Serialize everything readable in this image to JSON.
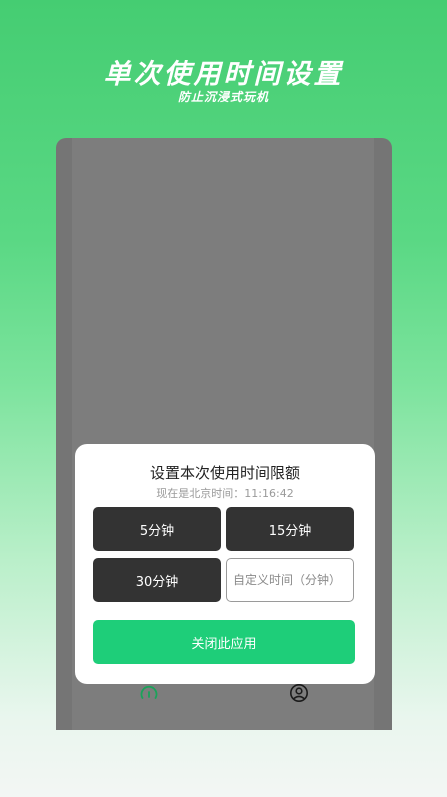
{
  "hero": {
    "title": "单次使用时间设置",
    "subtitle": "防止沉浸式玩机"
  },
  "dialog": {
    "title": "设置本次使用时间限额",
    "current_time_text": "现在是北京时间：11:16:42",
    "options": [
      {
        "label": "5分钟"
      },
      {
        "label": "15分钟"
      },
      {
        "label": "30分钟"
      }
    ],
    "custom_input_placeholder": "自定义时间（分钟）",
    "close_label": "关闭此应用"
  },
  "tabbar": {
    "icons": [
      "timer-icon",
      "profile-icon"
    ]
  },
  "colors": {
    "accent": "#1ece79",
    "option_bg": "#333333",
    "timer_icon": "#1aa35a",
    "profile_icon": "#1b1b1b"
  }
}
